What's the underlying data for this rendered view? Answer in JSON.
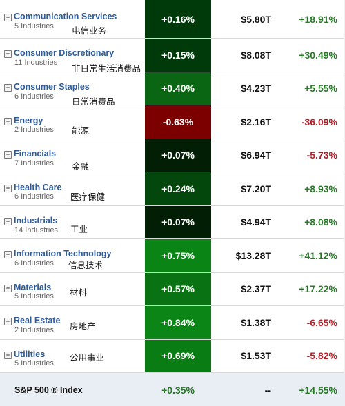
{
  "sectors": [
    {
      "name": "Communication Services",
      "industries": "5 Industries",
      "cn": "电信业务",
      "change": "+0.16%",
      "change_color": "#013a0a",
      "market_cap": "$5.80T",
      "ytd": "+18.91%",
      "ytd_sign": "pos"
    },
    {
      "name": "Consumer Discretionary",
      "industries": "11 Industries",
      "cn": "非日常生活消费品",
      "change": "+0.15%",
      "change_color": "#013a0a",
      "market_cap": "$8.08T",
      "ytd": "+30.49%",
      "ytd_sign": "pos"
    },
    {
      "name": "Consumer Staples",
      "industries": "6 Industries",
      "cn": "日常消费品",
      "change": "+0.40%",
      "change_color": "#0a6612",
      "market_cap": "$4.23T",
      "ytd": "+5.55%",
      "ytd_sign": "pos"
    },
    {
      "name": "Energy",
      "industries": "2 Industries",
      "cn": "能源",
      "change": "-0.63%",
      "change_color": "#7d0000",
      "market_cap": "$2.16T",
      "ytd": "-36.09%",
      "ytd_sign": "neg"
    },
    {
      "name": "Financials",
      "industries": "7 Industries",
      "cn": "金融",
      "change": "+0.07%",
      "change_color": "#021f06",
      "market_cap": "$6.94T",
      "ytd": "-5.73%",
      "ytd_sign": "neg"
    },
    {
      "name": "Health Care",
      "industries": "6 Industries",
      "cn": "医疗保健",
      "change": "+0.24%",
      "change_color": "#03470c",
      "market_cap": "$7.20T",
      "ytd": "+8.93%",
      "ytd_sign": "pos"
    },
    {
      "name": "Industrials",
      "industries": "14 Industries",
      "cn": "工业",
      "change": "+0.07%",
      "change_color": "#021f06",
      "market_cap": "$4.94T",
      "ytd": "+8.08%",
      "ytd_sign": "pos"
    },
    {
      "name": "Information Technology",
      "industries": "6 Industries",
      "cn": "信息技术",
      "change": "+0.75%",
      "change_color": "#0b8416",
      "market_cap": "$13.28T",
      "ytd": "+41.12%",
      "ytd_sign": "pos"
    },
    {
      "name": "Materials",
      "industries": "5 Industries",
      "cn": "材料",
      "change": "+0.57%",
      "change_color": "#097212",
      "market_cap": "$2.37T",
      "ytd": "+17.22%",
      "ytd_sign": "pos"
    },
    {
      "name": "Real Estate",
      "industries": "2 Industries",
      "cn": "房地产",
      "change": "+0.84%",
      "change_color": "#0b8616",
      "market_cap": "$1.38T",
      "ytd": "-6.65%",
      "ytd_sign": "neg"
    },
    {
      "name": "Utilities",
      "industries": "5 Industries",
      "cn": "公用事业",
      "change": "+0.69%",
      "change_color": "#0a7c14",
      "market_cap": "$1.53T",
      "ytd": "-5.82%",
      "ytd_sign": "neg"
    }
  ],
  "index": {
    "label": "S&P 500 ® Index",
    "change": "+0.35%",
    "market_cap": "--",
    "ytd": "+14.55%"
  },
  "icons": {
    "expand": "+"
  }
}
